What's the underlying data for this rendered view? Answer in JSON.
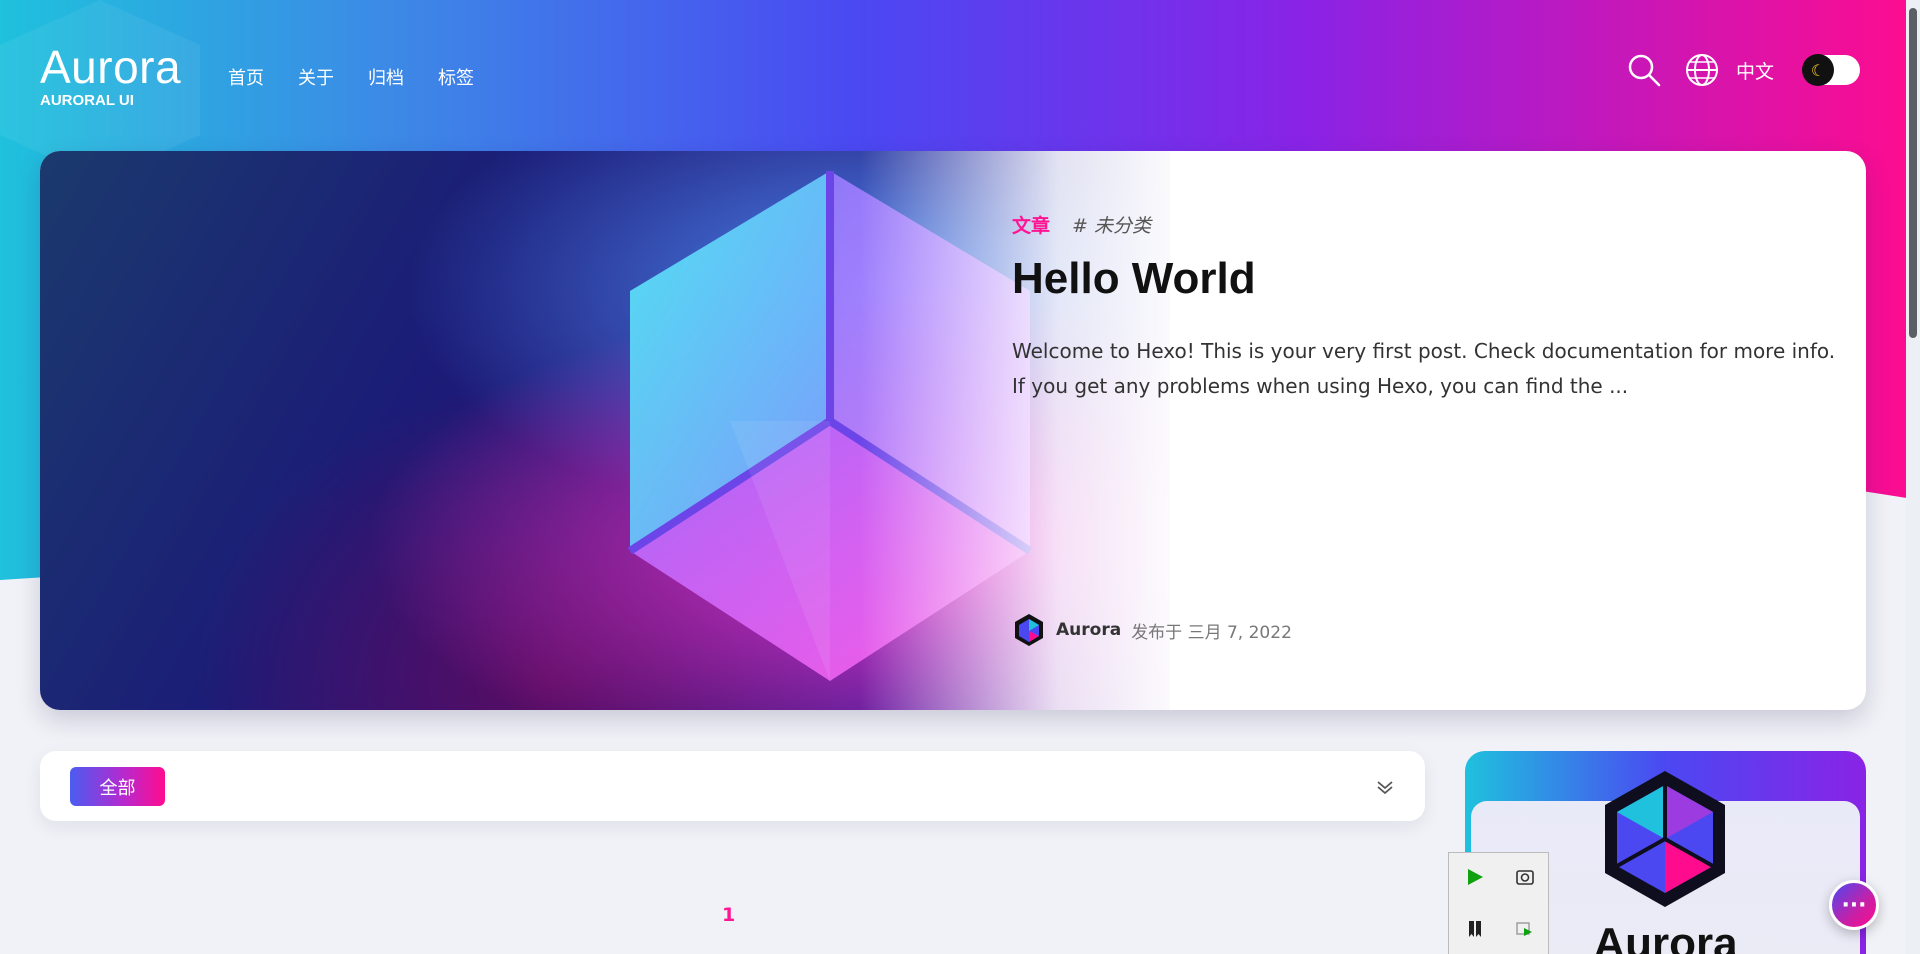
{
  "brand": {
    "title": "Aurora",
    "subtitle": "AURORAL UI"
  },
  "nav": {
    "links": [
      "首页",
      "关于",
      "归档",
      "标签"
    ]
  },
  "header_right": {
    "language": "中文",
    "theme_icon": "moon-icon"
  },
  "feature": {
    "category": "文章",
    "tag": "# 未分类",
    "title": "Hello World",
    "excerpt": "Welcome to Hexo! This is your very first post. Check documentation for more info. If you get any problems when using Hexo, you can find the ...",
    "author": "Aurora",
    "date": "发布于 三月 7, 2022"
  },
  "filter": {
    "active_label": "全部"
  },
  "pagination": {
    "current": "1"
  },
  "profile": {
    "name": "Aurora"
  },
  "fab": {
    "label": "···"
  },
  "colors": {
    "accent": "#ff1493",
    "brand_purple": "#4b48f2",
    "brand_cyan": "#1fc1dd"
  }
}
